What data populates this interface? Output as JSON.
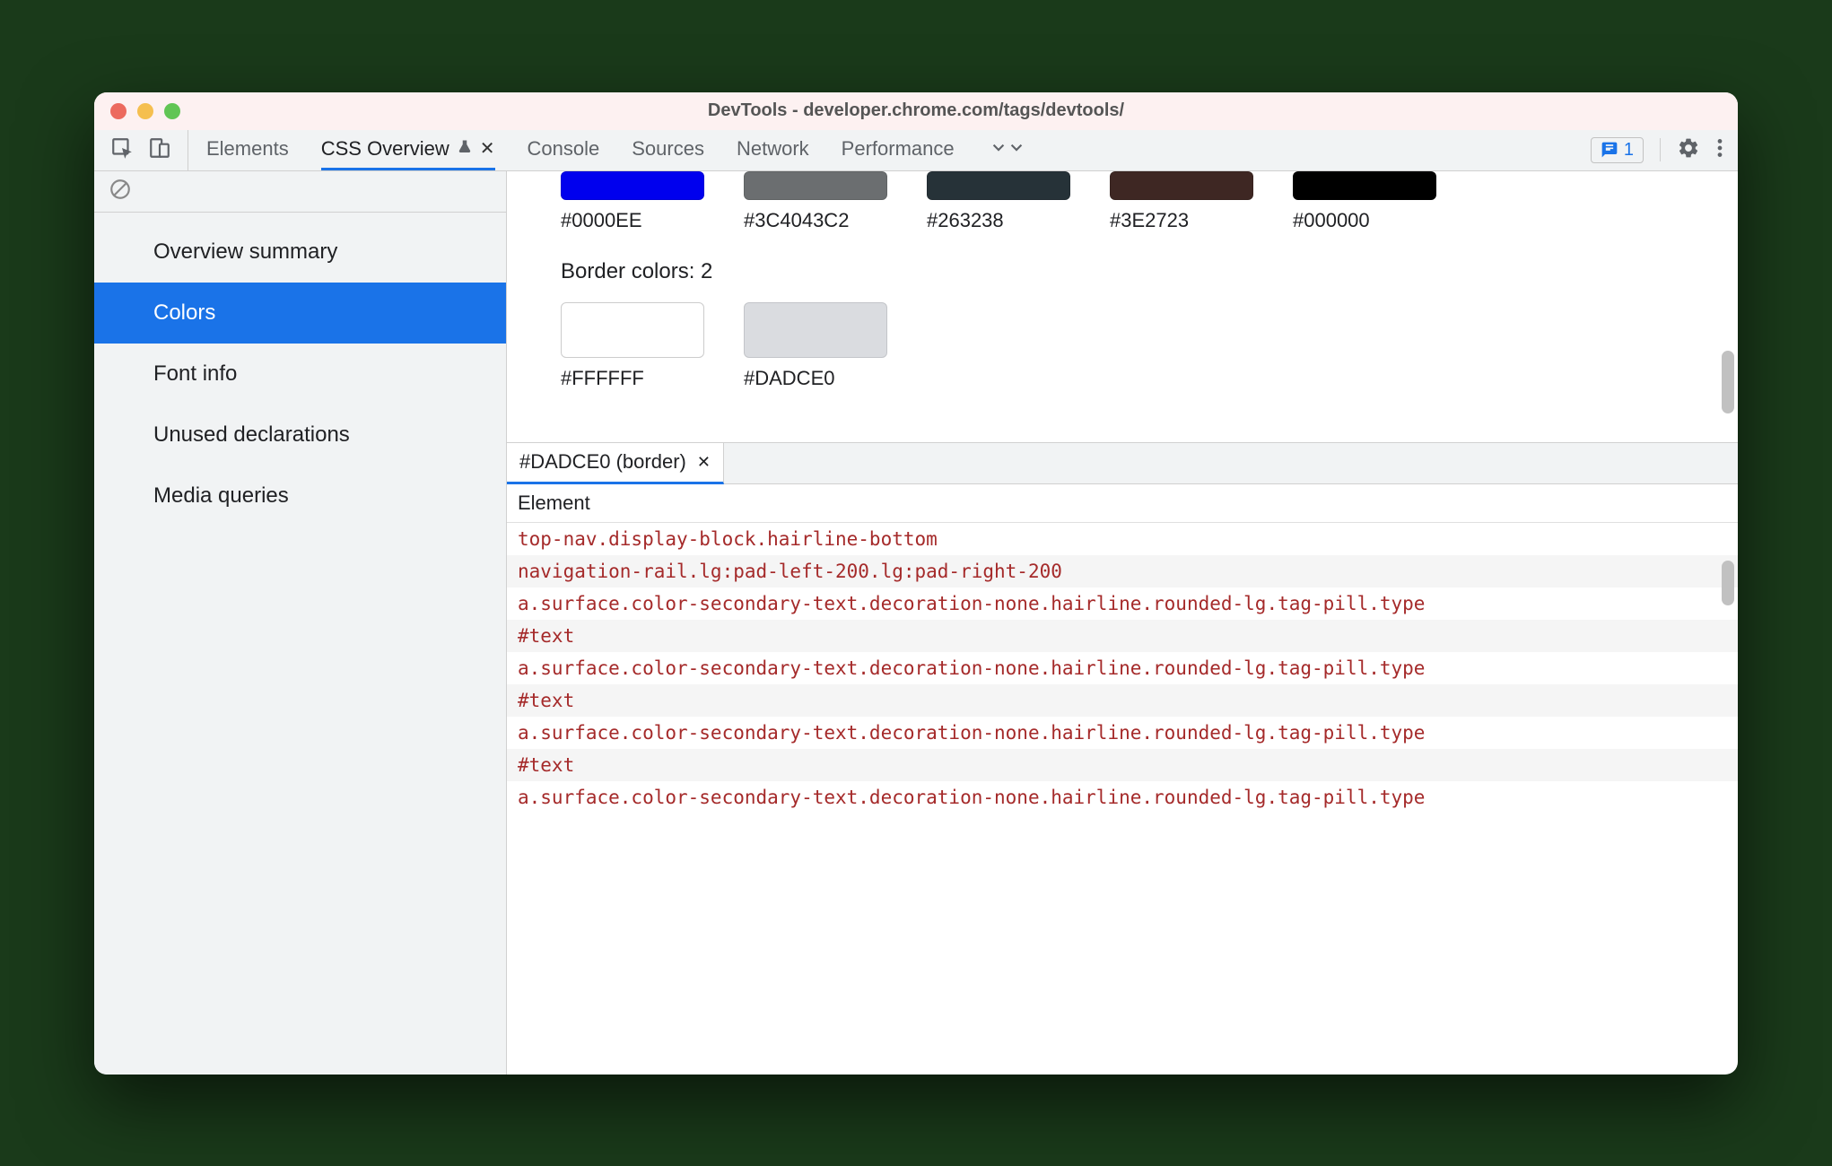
{
  "window_title": "DevTools - developer.chrome.com/tags/devtools/",
  "tabs": {
    "items": [
      "Elements",
      "CSS Overview",
      "Console",
      "Sources",
      "Network",
      "Performance"
    ],
    "active_index": 1
  },
  "issues_count": "1",
  "sidebar": {
    "items": [
      "Overview summary",
      "Colors",
      "Font info",
      "Unused declarations",
      "Media queries"
    ],
    "selected_index": 1
  },
  "top_swatches": [
    {
      "hex": "#0000EE",
      "label": "#0000EE"
    },
    {
      "hex": "#3C4043",
      "alpha": "C2",
      "label": "#3C4043C2"
    },
    {
      "hex": "#263238",
      "label": "#263238"
    },
    {
      "hex": "#3E2723",
      "label": "#3E2723"
    },
    {
      "hex": "#000000",
      "label": "#000000"
    }
  ],
  "border_section": {
    "heading": "Border colors: 2",
    "swatches": [
      {
        "hex": "#FFFFFF",
        "label": "#FFFFFF"
      },
      {
        "hex": "#DADCE0",
        "label": "#DADCE0"
      }
    ]
  },
  "details": {
    "tab_label": "#DADCE0 (border)",
    "column_header": "Element",
    "rows": [
      "top-nav.display-block.hairline-bottom",
      "navigation-rail.lg:pad-left-200.lg:pad-right-200",
      "a.surface.color-secondary-text.decoration-none.hairline.rounded-lg.tag-pill.type",
      "#text",
      "a.surface.color-secondary-text.decoration-none.hairline.rounded-lg.tag-pill.type",
      "#text",
      "a.surface.color-secondary-text.decoration-none.hairline.rounded-lg.tag-pill.type",
      "#text",
      "a.surface.color-secondary-text.decoration-none.hairline.rounded-lg.tag-pill.type"
    ]
  }
}
